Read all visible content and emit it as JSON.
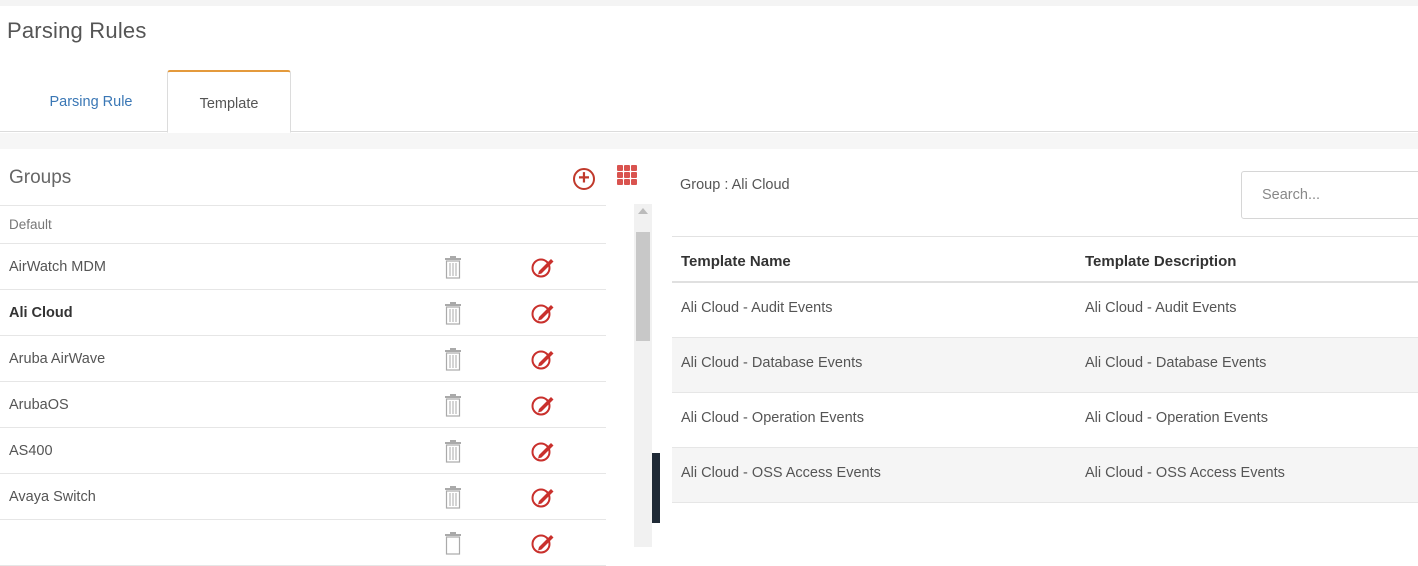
{
  "page": {
    "title": "Parsing Rules"
  },
  "tabs": [
    {
      "label": "Parsing Rule",
      "active": false
    },
    {
      "label": "Template",
      "active": true
    }
  ],
  "groups": {
    "title": "Groups",
    "items": [
      {
        "label": "Default"
      },
      {
        "label": "AirWatch MDM"
      },
      {
        "label": "Ali Cloud",
        "selected": true
      },
      {
        "label": "Aruba AirWave"
      },
      {
        "label": "ArubaOS"
      },
      {
        "label": "AS400"
      },
      {
        "label": "Avaya Switch"
      },
      {
        "label": ""
      }
    ]
  },
  "detail": {
    "group_label": "Group : Ali Cloud",
    "search_placeholder": "Search...",
    "columns": [
      "Template Name",
      "Template Description"
    ],
    "rows": [
      [
        "Ali Cloud - Audit Events",
        "Ali Cloud - Audit Events"
      ],
      [
        "Ali Cloud - Database Events",
        "Ali Cloud - Database Events"
      ],
      [
        "Ali Cloud - Operation Events",
        "Ali Cloud - Operation Events"
      ],
      [
        "Ali Cloud - OSS Access Events",
        "Ali Cloud - OSS Access Events"
      ]
    ]
  },
  "colors": {
    "accent_tab": "#e49a3c",
    "link": "#3a77b5",
    "icon_red": "#c0392b"
  }
}
